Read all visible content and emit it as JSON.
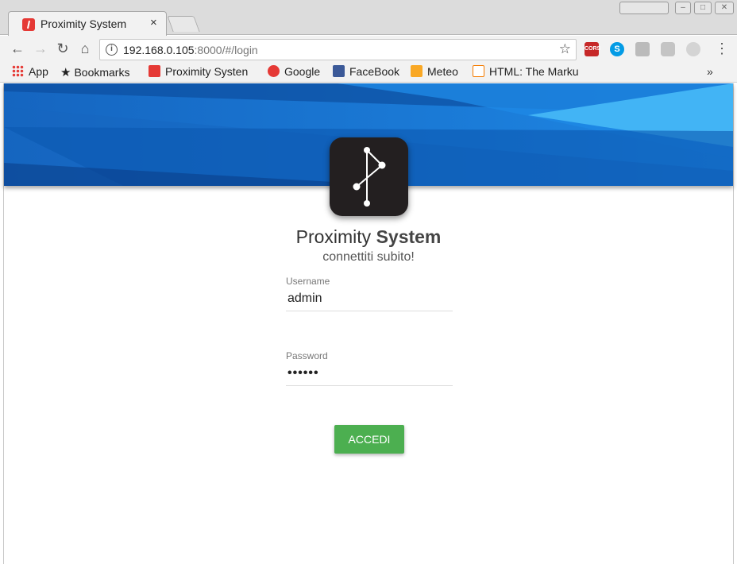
{
  "browser": {
    "tab_title": "Proximity System",
    "tab_close": "×",
    "url_host": "192.168.0.105",
    "url_rest": ":8000/#/login",
    "bookmarks": [
      {
        "label": "App",
        "icon": "apps-grid-icon"
      },
      {
        "label": "Bookmarks",
        "icon": "star-icon"
      },
      {
        "label": "Proximity Systen",
        "icon": "proximity-favicon"
      },
      {
        "label": "Google",
        "icon": "google-icon"
      },
      {
        "label": "FaceBook",
        "icon": "facebook-icon"
      },
      {
        "label": "Meteo",
        "icon": "meteo-icon"
      },
      {
        "label": "HTML: The Marku",
        "icon": "w3schools-icon"
      }
    ],
    "more_bookmarks": "»",
    "extensions": [
      {
        "name": "cors-extension-icon",
        "label": "CORS",
        "color": "#c62828"
      },
      {
        "name": "skype-icon",
        "label": "S",
        "color": "#039be5"
      }
    ]
  },
  "login": {
    "brand_light": "Proximity",
    "brand_bold": "System",
    "subtitle": "connettiti subito!",
    "username_label": "Username",
    "username_value": "admin",
    "password_label": "Password",
    "password_value": "••••••",
    "submit_label": "ACCEDI"
  },
  "colors": {
    "banner": "#1e74c9",
    "button": "#4caf50",
    "logo_bg": "#231f20"
  }
}
